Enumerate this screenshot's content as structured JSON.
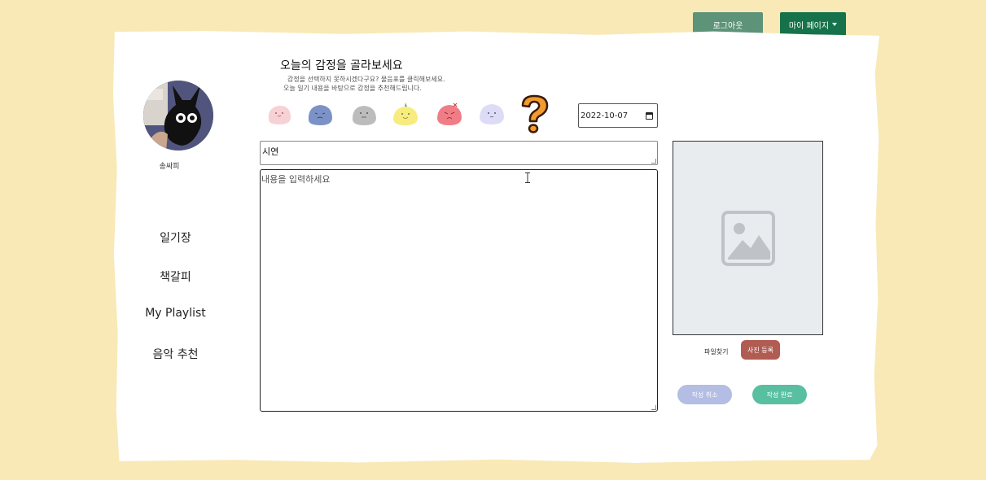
{
  "header": {
    "logout_label": "로그아웃",
    "mypage_label": "마이 페이지"
  },
  "profile": {
    "nickname": "송싸피"
  },
  "nav": {
    "items": [
      {
        "label": "일기장"
      },
      {
        "label": "책갈피"
      },
      {
        "label": "My Playlist"
      },
      {
        "label": "음악 추천"
      }
    ]
  },
  "emotion": {
    "title": "오늘의 감정을 골라보세요",
    "subtitle_line1": "감정을 선택하지 못하시겠다구요? 물음표를 클릭해보세요.",
    "subtitle_line2": "오늘 일기 내용을 바탕으로 감정을 추천해드립니다.",
    "options": [
      {
        "icon": "pink-blob-emotion-icon",
        "color": "#f7d2d4"
      },
      {
        "icon": "blue-blob-emotion-icon",
        "color": "#7b92c6"
      },
      {
        "icon": "gray-blob-emotion-icon",
        "color": "#bcbcbc"
      },
      {
        "icon": "yellow-blob-emotion-icon",
        "color": "#f7ec7d"
      },
      {
        "icon": "red-blob-emotion-icon",
        "color": "#f07d86"
      },
      {
        "icon": "lavender-blob-emotion-icon",
        "color": "#dcdcf7"
      },
      {
        "icon": "question-mark-icon",
        "color": "#f29b2e"
      }
    ]
  },
  "diary": {
    "date": "2022-10-07",
    "title_value": "시연",
    "content_placeholder": "내용을 입력하세요"
  },
  "photo": {
    "find_file_label": "파일찾기",
    "register_label": "사진 등록"
  },
  "actions": {
    "cancel_label": "작성 취소",
    "done_label": "작성 완료"
  },
  "colors": {
    "background": "#f8e9b6",
    "logout_button": "#5c9379",
    "mypage_button": "#15724a",
    "register_button": "#b15c52",
    "cancel_button": "#b4bde3",
    "done_button": "#58bfa0"
  }
}
